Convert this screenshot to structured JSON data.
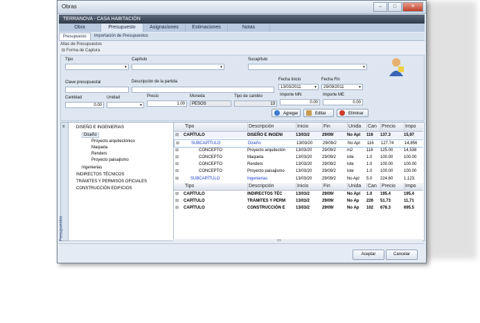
{
  "window": {
    "title": "Obras"
  },
  "header": {
    "title": "TERRANOVA - CASA HABITACIÓN"
  },
  "tabs1": [
    "Obra",
    "Presupuesto",
    "Asignaciones",
    "Estimaciones",
    "Notas"
  ],
  "tabs2": [
    "Presupuesto",
    "Importación de Presupuestos"
  ],
  "section": {
    "alta": "Altas de Presupuestos",
    "forma": "Forma de Captura"
  },
  "form": {
    "tipo_label": "Tipo",
    "capitulo_label": "Capítulo",
    "subcap_label": "Sucapítulo",
    "clave_label": "Clave presupuestal",
    "desc_label": "Descripción de la partida",
    "fecha_inicio_label": "Fecha Inicio",
    "fecha_inicio": "13/03/2011",
    "fecha_fin_label": "Fecha Fin",
    "fecha_fin": "29/09/2011",
    "cantidad_label": "Cantidad",
    "cantidad": "0.00",
    "unidad_label": "Unidad",
    "precio_label": "Precio",
    "precio": "1.00",
    "moneda_label": "Moneda",
    "moneda": "PESOS",
    "tipo_cambio_label": "Tipo de cambio",
    "tipo_cambio": "13",
    "importe_mn_label": "Importe MN",
    "importe_mn": "0.00",
    "importe_me_label": "Importe ME",
    "importe_me": "0.00",
    "btn_agregar": "Agregar",
    "btn_editar": "Editar",
    "btn_eliminar": "Eliminar"
  },
  "tree": {
    "items": [
      {
        "label": "DISEÑO E INGENIERIAS",
        "level": 0
      },
      {
        "label": "Diseño",
        "level": 1
      },
      {
        "label": "Proyecto arquitectónico",
        "level": 2
      },
      {
        "label": "Maqueta",
        "level": 2
      },
      {
        "label": "Renders",
        "level": 2
      },
      {
        "label": "Proyecto paisajismo",
        "level": 2
      },
      {
        "label": "Ingenierias",
        "level": 1
      },
      {
        "label": "INDIRECTOS TÉCNICOS",
        "level": 0
      },
      {
        "label": "TRÁMITES Y PERMISOS OFICIALES",
        "level": 0
      },
      {
        "label": "CONSTRUCCIÓN EDIFICIOS",
        "level": 0
      }
    ],
    "side_label": "Presupuestos"
  },
  "grid": {
    "columns": [
      "Tipo",
      "Descripción",
      "Inicio",
      "Fin",
      "Unida",
      "Can",
      "Precio",
      "Impo"
    ],
    "rows": [
      [
        "CAPÍTULO",
        "DISEÑO E INGENI",
        "13/03/2",
        "29/09/",
        "No Apl",
        "116",
        "137.3",
        "15,97"
      ],
      [
        "SUBCAPÍTULO",
        "Diseño",
        "13/03/20",
        "29/09/2",
        "No Apl",
        "116",
        "127.74",
        "14,856"
      ],
      [
        "CONCEPTO",
        "Proyecto arquitectón",
        "13/03/20",
        "29/09/2",
        "m2",
        "116",
        "125.00",
        "14,538"
      ],
      [
        "CONCEPTO",
        "Maqueta",
        "13/03/20",
        "29/09/2",
        "lote",
        "1.0",
        "100.00",
        "100.00"
      ],
      [
        "CONCEPTO",
        "Renders",
        "13/03/20",
        "29/09/2",
        "lote",
        "1.0",
        "100.00",
        "100.00"
      ],
      [
        "CONCEPTO",
        "Proyecto paisajismo",
        "13/03/20",
        "29/09/2",
        "lote",
        "1.0",
        "100.00",
        "100.00"
      ],
      [
        "SUBCAPÍTULO",
        "Ingenierias",
        "13/03/20",
        "29/09/2",
        "No Apl",
        "5.0",
        "224.60",
        "1,123."
      ],
      [
        "Tipo",
        "Descripción",
        "Inicio",
        "Fin",
        "Unida",
        "Can",
        "Precio",
        "Impo"
      ],
      [
        "CAPÍTULO",
        "INDIRECTOS TÉC",
        "13/03/2",
        "29/09/",
        "No Apl",
        "1.0",
        "195.4",
        "195,4"
      ],
      [
        "CAPÍTULO",
        "TRÁMITES Y PERM",
        "13/03/2",
        "29/09/",
        "No Ap",
        "226",
        "51.73",
        "11,71"
      ],
      [
        "CAPÍTULO",
        "CONSTRUCCIÓN E",
        "13/03/2",
        "29/09/",
        "No Ap",
        "102",
        "678.3",
        "695.5"
      ]
    ]
  },
  "footer": {
    "aceptar": "Aceptar",
    "cancelar": "Cancelar"
  },
  "colors": {
    "header": "#2f3a48",
    "accent": "#1e3c8c",
    "link": "#1a3cc8"
  }
}
